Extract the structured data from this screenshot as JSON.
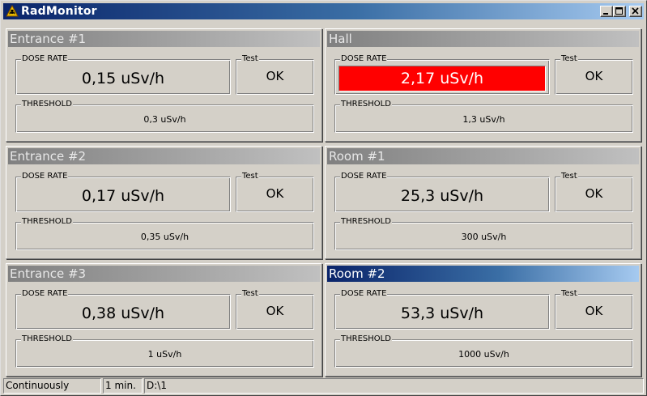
{
  "window": {
    "title": "RadMonitor",
    "icon": "radiation-warning-icon"
  },
  "labels": {
    "dose_rate": "DOSE RATE",
    "test": "Test",
    "threshold": "THRESHOLD"
  },
  "panels": [
    {
      "name": "Entrance #1",
      "dose_rate": "0,15 uSv/h",
      "test": "OK",
      "threshold": "0,3 uSv/h",
      "alarm": false,
      "active": false
    },
    {
      "name": "Hall",
      "dose_rate": "2,17 uSv/h",
      "test": "OK",
      "threshold": "1,3 uSv/h",
      "alarm": true,
      "active": false
    },
    {
      "name": "Entrance #2",
      "dose_rate": "0,17 uSv/h",
      "test": "OK",
      "threshold": "0,35 uSv/h",
      "alarm": false,
      "active": false
    },
    {
      "name": "Room #1",
      "dose_rate": "25,3 uSv/h",
      "test": "OK",
      "threshold": "300 uSv/h",
      "alarm": false,
      "active": false
    },
    {
      "name": "Entrance #3",
      "dose_rate": "0,38 uSv/h",
      "test": "OK",
      "threshold": "1 uSv/h",
      "alarm": false,
      "active": false
    },
    {
      "name": "Room #2",
      "dose_rate": "53,3 uSv/h",
      "test": "OK",
      "threshold": "1000 uSv/h",
      "alarm": false,
      "active": true
    }
  ],
  "statusbar": {
    "mode": "Continuously",
    "interval": "1 min.",
    "path": "D:\\1"
  },
  "colors": {
    "alarm": "#ff0000",
    "title_active_start": "#0a246a",
    "title_active_end": "#a6caf0",
    "title_inactive": "#808080",
    "face": "#d4d0c8"
  }
}
